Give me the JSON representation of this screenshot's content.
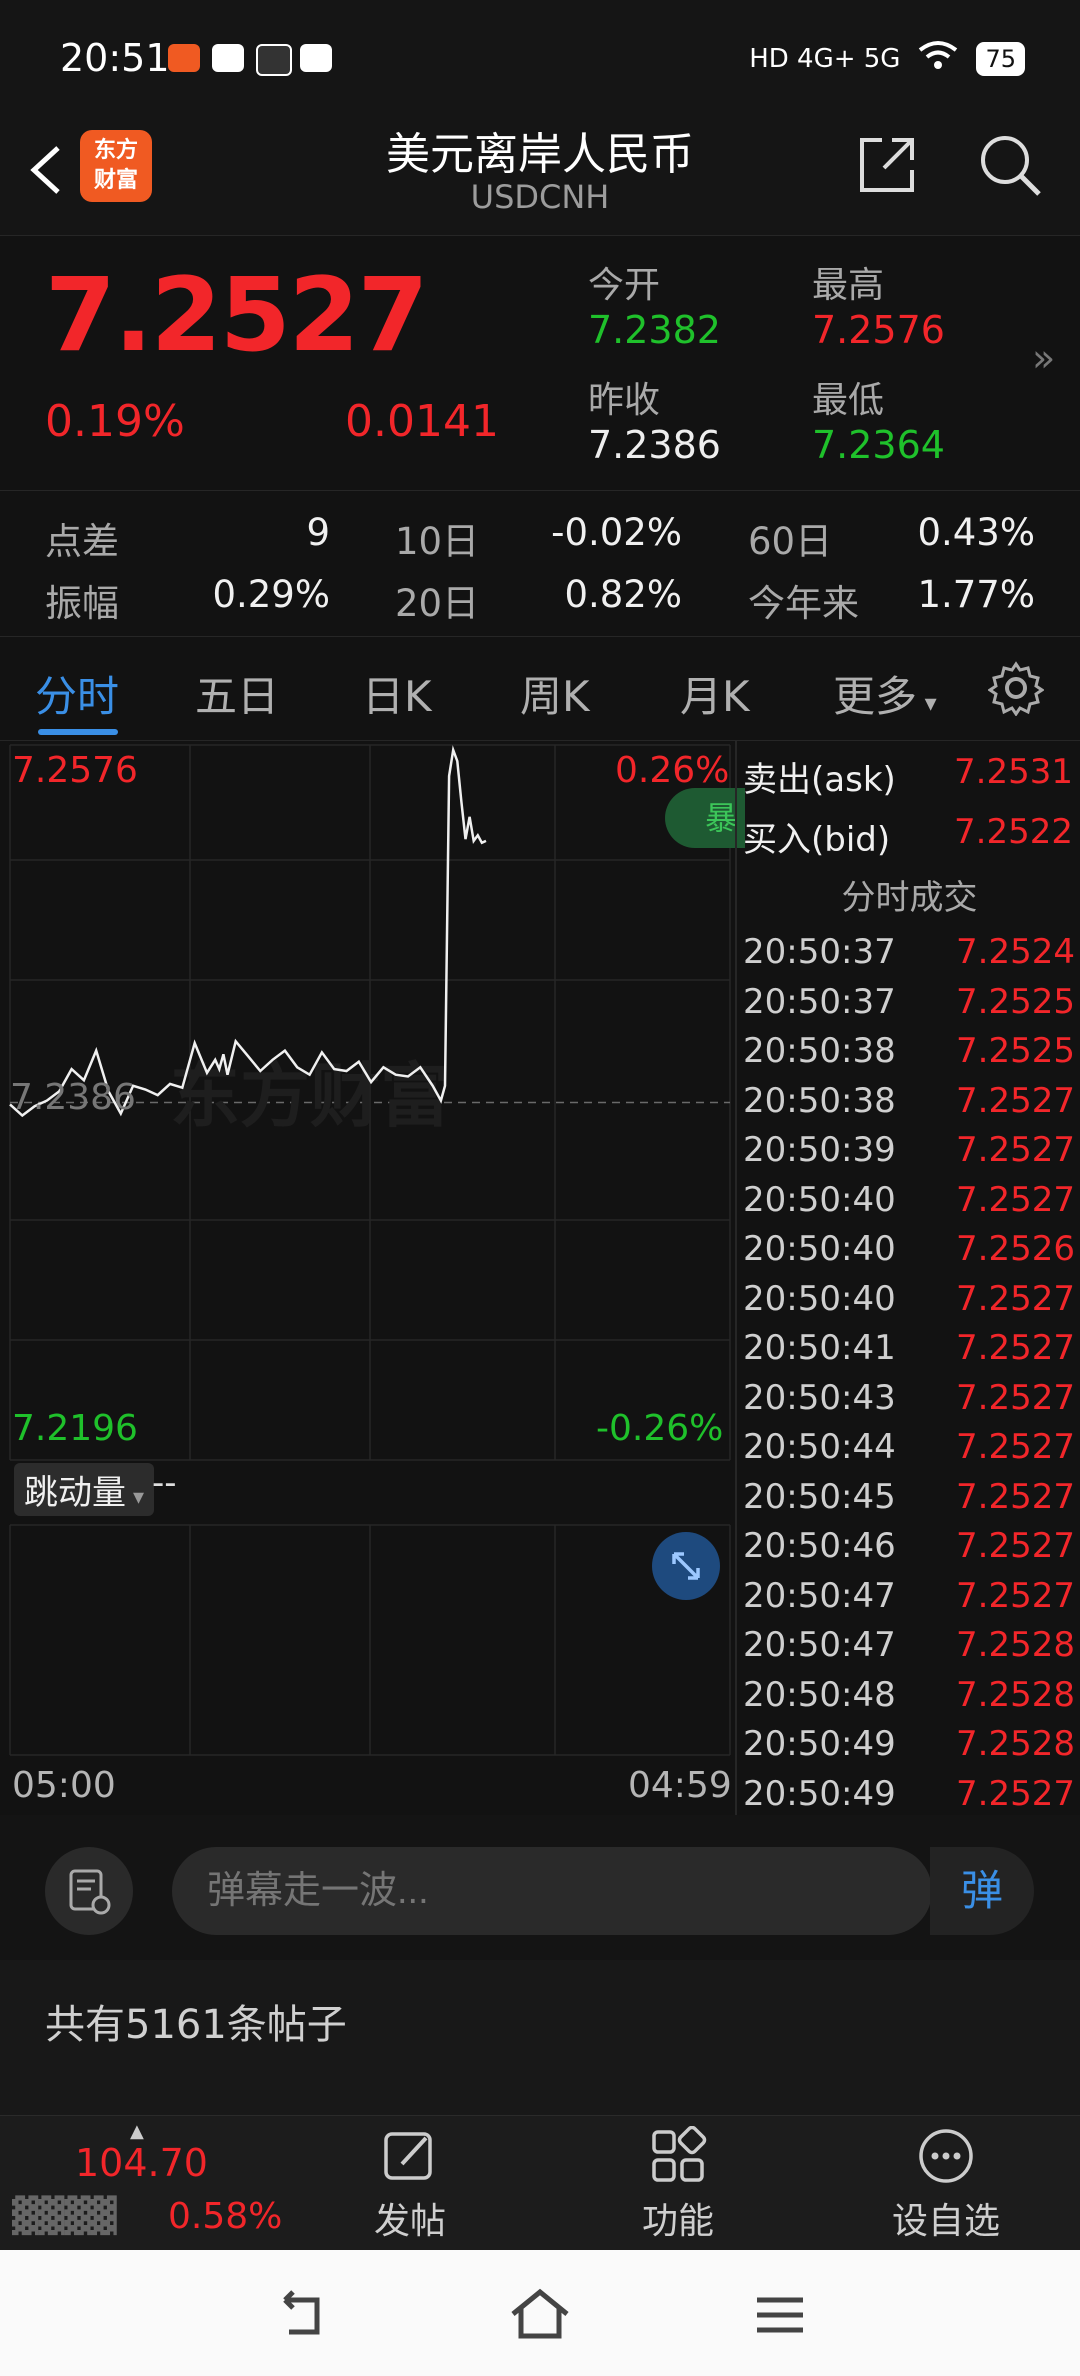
{
  "status_bar": {
    "time": "20:51",
    "network": "HD 4G+ 5G",
    "battery": "75"
  },
  "header": {
    "title": "美元离岸人民币",
    "subtitle": "USDCNH",
    "logo": "东方\n财富"
  },
  "quote": {
    "price": "7.2527",
    "change_pct": "0.19%",
    "change": "0.0141",
    "open_label": "今开",
    "open": "7.2382",
    "high_label": "最高",
    "high": "7.2576",
    "prev_close_label": "昨收",
    "prev_close": "7.2386",
    "low_label": "最低",
    "low": "7.2364"
  },
  "stats": {
    "spread_label": "点差",
    "spread": "9",
    "d10_label": "10日",
    "d10": "-0.02%",
    "d60_label": "60日",
    "d60": "0.43%",
    "amplitude_label": "振幅",
    "amplitude": "0.29%",
    "d20_label": "20日",
    "d20": "0.82%",
    "ytd_label": "今年来",
    "ytd": "1.77%"
  },
  "tabs": [
    "分时",
    "五日",
    "日K",
    "周K",
    "月K",
    "更多"
  ],
  "chart": {
    "top_price": "7.2576",
    "top_pct": "0.26%",
    "mid_price": "7.2386",
    "bottom_price": "7.2196",
    "bottom_pct": "-0.26%",
    "time_start": "05:00",
    "time_end": "04:59",
    "alert_pill": "暴",
    "volume_selector": "跳动量",
    "volume_value": "--",
    "watermark": "东方财富"
  },
  "chart_data": {
    "type": "line",
    "title": "",
    "ylim": [
      7.2196,
      7.2576
    ],
    "baseline": 7.2386,
    "x": [
      0,
      6,
      12,
      18,
      24,
      30,
      36,
      42,
      48,
      54,
      60,
      66,
      72,
      78,
      84,
      90,
      96,
      100,
      102,
      104,
      106,
      110,
      116,
      122,
      128,
      134,
      140,
      146,
      152,
      158,
      164,
      170,
      176,
      182,
      188,
      194,
      200,
      206,
      210,
      212,
      214,
      216,
      218,
      220,
      222,
      224,
      226,
      228,
      230,
      232
    ],
    "values": [
      7.2385,
      7.2379,
      7.2384,
      7.2387,
      7.2392,
      7.2404,
      7.2398,
      7.2414,
      7.2392,
      7.238,
      7.2395,
      7.2393,
      7.239,
      7.2396,
      7.2394,
      7.2418,
      7.2402,
      7.2409,
      7.2404,
      7.2412,
      7.2401,
      7.2419,
      7.2411,
      7.2403,
      7.2409,
      7.2414,
      7.2405,
      7.2401,
      7.2413,
      7.2404,
      7.2403,
      7.2408,
      7.2397,
      7.2405,
      7.2401,
      7.24,
      7.2405,
      7.2395,
      7.2387,
      7.2395,
      7.2562,
      7.2576,
      7.257,
      7.2548,
      7.2528,
      7.254,
      7.2527,
      7.253,
      7.2526,
      7.2527
    ]
  },
  "orderbook": {
    "ask_label": "卖出(ask)",
    "ask": "7.2531",
    "bid_label": "买入(bid)",
    "bid": "7.2522",
    "trades_title": "分时成交",
    "trades": [
      {
        "time": "20:50:37",
        "price": "7.2524"
      },
      {
        "time": "20:50:37",
        "price": "7.2525"
      },
      {
        "time": "20:50:38",
        "price": "7.2525"
      },
      {
        "time": "20:50:38",
        "price": "7.2527"
      },
      {
        "time": "20:50:39",
        "price": "7.2527"
      },
      {
        "time": "20:50:40",
        "price": "7.2527"
      },
      {
        "time": "20:50:40",
        "price": "7.2526"
      },
      {
        "time": "20:50:40",
        "price": "7.2527"
      },
      {
        "time": "20:50:41",
        "price": "7.2527"
      },
      {
        "time": "20:50:43",
        "price": "7.2527"
      },
      {
        "time": "20:50:44",
        "price": "7.2527"
      },
      {
        "time": "20:50:45",
        "price": "7.2527"
      },
      {
        "time": "20:50:46",
        "price": "7.2527"
      },
      {
        "time": "20:50:47",
        "price": "7.2527"
      },
      {
        "time": "20:50:47",
        "price": "7.2528"
      },
      {
        "time": "20:50:48",
        "price": "7.2528"
      },
      {
        "time": "20:50:49",
        "price": "7.2528"
      },
      {
        "time": "20:50:49",
        "price": "7.2527"
      }
    ]
  },
  "danmaku": {
    "placeholder": "弹幕走一波...",
    "send_label": "弹"
  },
  "posts": {
    "count_text": "共有5161条帖子"
  },
  "bottom_bar": {
    "index_value": "104.70",
    "index_pct": "0.58%",
    "post_label": "发帖",
    "function_label": "功能",
    "watchlist_label": "设自选"
  },
  "colors": {
    "up": "#f2262a",
    "down": "#1fc12b",
    "accent": "#3a8fe6",
    "bg": "#121212"
  }
}
